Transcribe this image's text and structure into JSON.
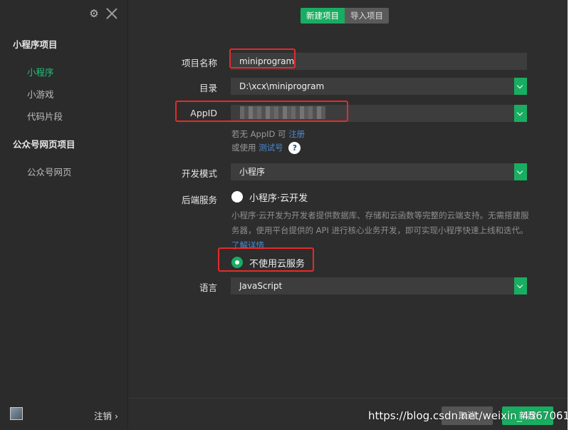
{
  "header": {
    "tabs": [
      {
        "label": "新建项目",
        "active": true
      },
      {
        "label": "导入项目",
        "active": false
      }
    ]
  },
  "sidebar": {
    "sections": [
      {
        "title": "小程序项目",
        "items": [
          "小程序",
          "小游戏",
          "代码片段"
        ]
      },
      {
        "title": "公众号网页项目",
        "items": [
          "公众号网页"
        ]
      }
    ],
    "logout_label": "注销 ›"
  },
  "form": {
    "project_name": {
      "label": "项目名称",
      "value": "miniprogram"
    },
    "directory": {
      "label": "目录",
      "value": "D:\\xcx\\miniprogram"
    },
    "appid": {
      "label": "AppID",
      "value": ""
    },
    "appid_hint": {
      "prefix": "若无 AppID 可",
      "link": "注册"
    },
    "test_hint": {
      "prefix": "或使用",
      "link": "测试号",
      "help": "?"
    },
    "dev_mode": {
      "label": "开发模式",
      "value": "小程序"
    },
    "backend": {
      "label": "后端服务",
      "option_cloud": "小程序·云开发",
      "cloud_desc": "小程序·云开发为开发者提供数据库、存储和云函数等完整的云端支持。无需搭建服务器，使用平台提供的 API 进行核心业务开发，即可实现小程序快速上线和迭代。",
      "cloud_link": "了解详情",
      "option_none": "不使用云服务"
    },
    "language": {
      "label": "语言",
      "value": "JavaScript"
    }
  },
  "footer": {
    "cancel_label": "取消",
    "create_label": "新建"
  },
  "watermark": "https://blog.csdn.net/weixin_45670610",
  "colors": {
    "accent": "#19ad61",
    "link": "#4a89d6",
    "highlight": "#e52a2a"
  }
}
